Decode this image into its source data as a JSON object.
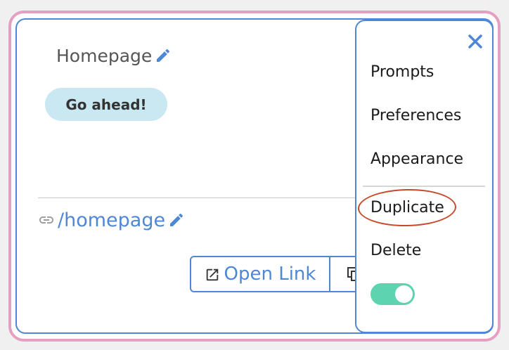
{
  "page": {
    "title": "Homepage",
    "cta_label": "Go ahead!",
    "link_path": "/homepage",
    "open_link_label": "Open Link"
  },
  "menu": {
    "items": [
      {
        "label": "Prompts"
      },
      {
        "label": "Preferences"
      },
      {
        "label": "Appearance"
      },
      {
        "label": "Duplicate",
        "highlighted": true
      },
      {
        "label": "Delete"
      }
    ],
    "toggle_on": true
  },
  "colors": {
    "accent": "#4d87d6",
    "frame": "#e59fc2",
    "cta_bg": "#c9e8f1",
    "toggle": "#5ed3b0",
    "highlight": "#c64a2a"
  },
  "icons": {
    "edit": "pencil-icon",
    "link": "link-icon",
    "external": "external-link-icon",
    "copy": "copy-icon",
    "close": "close-icon"
  }
}
